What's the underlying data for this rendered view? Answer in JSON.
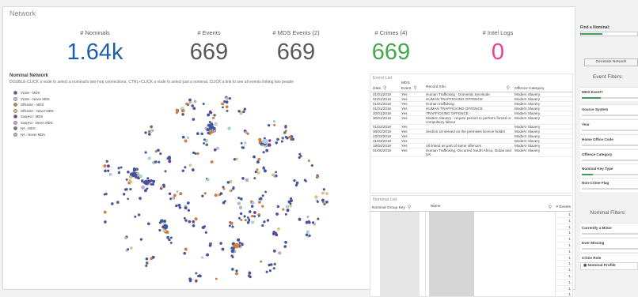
{
  "sheet": {
    "title": "Network"
  },
  "kpis": [
    {
      "label": "# Nominals",
      "value": "1.64k",
      "color": "#1f5fa8"
    },
    {
      "label": "# Events",
      "value": "669",
      "color": "#595959"
    },
    {
      "label": "# MDS Events (2)",
      "value": "669",
      "color": "#595959"
    },
    {
      "label": "# Crimes (4)",
      "value": "669",
      "color": "#45a74c"
    },
    {
      "label": "# Intel Logs",
      "value": "0",
      "color": "#e94194"
    }
  ],
  "network": {
    "title": "Nominal Network",
    "hint": "DOUBLE-CLICK a node to select a nominal's two-hop connections, CTRL+CLICK a node to select just a nominal, CLICK a link to see all events linking two people",
    "legend": [
      {
        "label": "Victim - MDS",
        "color": "#3d55a8"
      },
      {
        "label": "Victim - Never MDS",
        "color": "#a9d8ea"
      },
      {
        "label": "Offender - MDS",
        "color": "#e6792f"
      },
      {
        "label": "Offender - Never MDS",
        "color": "#f2c46a"
      },
      {
        "label": "Suspect - MDS",
        "color": "#7b2fa0"
      },
      {
        "label": "Suspect - Never MDS",
        "color": "#c9a6dd"
      },
      {
        "label": "NA - MDS",
        "color": "#6d6d6d"
      },
      {
        "label": "NA - Never MDS",
        "color": "#bcbcbc"
      }
    ]
  },
  "event_list": {
    "title": "Event List",
    "columns": [
      "Date",
      "MDS Event",
      "Record Info",
      "Offence Category"
    ],
    "rows": [
      [
        "01/01/2018",
        "Yes",
        "Human Trafficking - Domestic Servitude",
        "Modern Slavery"
      ],
      [
        "01/01/2018",
        "Yes",
        "HUMAN TRAFFICKING OFFENCE",
        "Modern Slavery"
      ],
      [
        "01/01/2018",
        "Yes",
        "Human trafficking",
        "Modern Slavery"
      ],
      [
        "01/01/2018",
        "Yes",
        "HUMAN TRAFFICKING OFFENCE",
        "Modern Slavery"
      ],
      [
        "20/01/2018",
        "Yes",
        "TRAFFICKING OFFENCE -",
        "Modern Slavery"
      ],
      [
        "30/01/2018",
        "Yes",
        "Modern Slavery - require person to perform forced or compulsory labour",
        "Modern Slavery"
      ],
      [
        "01/02/2018",
        "Yes",
        "",
        "Modern Slavery"
      ],
      [
        "06/02/2018",
        "Yes",
        "Section 19 served on the premises licence holder",
        "Modern Slavery"
      ],
      [
        "22/03/2018",
        "Yes",
        "",
        "Modern Slavery"
      ],
      [
        "31/03/2018",
        "Yes",
        "",
        "Modern Slavery"
      ],
      [
        "19/04/2018",
        "Yes",
        "All linked as part of same offences",
        "Modern Slavery"
      ],
      [
        "01/05/2018",
        "Yes",
        "Human Trafficking, Occurred South Africa, Dubai and UK.",
        "Modern Slavery"
      ]
    ]
  },
  "nominal_list": {
    "title": "Nominal List",
    "columns": [
      "Nominal Group Key",
      "Name",
      "# Events"
    ],
    "counts": [
      "1",
      "1",
      "1",
      "1",
      "1",
      "1",
      "1",
      "1",
      "1",
      "1",
      "1",
      "1",
      "1",
      "1"
    ]
  },
  "sidebar": {
    "find_label": "Find a Nominal:",
    "generate_label": "Generate Network",
    "event_filters_title": "Event Filters:",
    "event_filters": [
      "MDS Event?",
      "Source System",
      "Year",
      "Home Office Code",
      "Offence Category",
      "Nominal Key Type",
      "Non-Crime Flag"
    ],
    "nominal_filters_title": "Nominal Filters:",
    "nominal_filters": [
      "Currently a Minor",
      "Ever Missing",
      "Crime Role"
    ],
    "profile_label": "Nominal Profile"
  }
}
